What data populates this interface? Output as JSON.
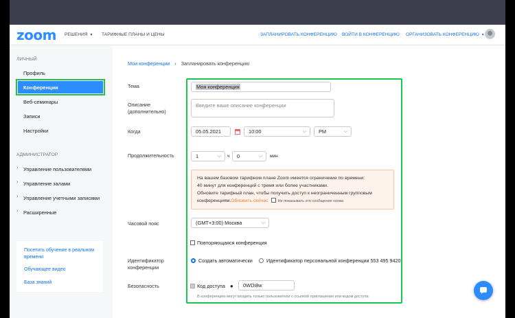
{
  "header": {
    "logo": "zoom",
    "nav": {
      "solutions": "РЕШЕНИЯ",
      "plans": "ТАРИФНЫЕ ПЛАНЫ И ЦЕНЫ",
      "schedule": "ЗАПЛАНИРОВАТЬ КОНФЕРЕНЦИЮ",
      "join": "ВОЙТИ В КОНФЕРЕНЦИЮ",
      "host": "ОРГАНИЗОВАТЬ КОНФЕРЕНЦИЮ"
    }
  },
  "sidebar": {
    "personal_heading": "ЛИЧНЫЙ",
    "personal_items": [
      "Профиль",
      "Конференции",
      "Веб-семинары",
      "Записи",
      "Настройки"
    ],
    "admin_heading": "АДМИНИСТРАТОР",
    "admin_items": [
      "Управление пользователями",
      "Управление залами",
      "Управление учетными записями",
      "Расширенные"
    ],
    "links": [
      "Посетить обучение в реальном времени",
      "Обучающее видео",
      "База знаний"
    ]
  },
  "breadcrumb": {
    "parent": "Мои конференции",
    "separator": "›",
    "current": "Запланировать конференцию"
  },
  "form": {
    "topic": {
      "label": "Тема",
      "value": "Моя конференция"
    },
    "description": {
      "label": "Описание (дополнительно)",
      "placeholder": "Введите ваше описание конференции"
    },
    "when": {
      "label": "Когда",
      "date": "05.05.2021",
      "time": "10:00",
      "ampm": "PM"
    },
    "duration": {
      "label": "Продолжительность",
      "hours": "1",
      "hours_unit": "ч",
      "minutes": "0",
      "minutes_unit": "мин"
    },
    "notice": {
      "line1": "На вашем базовом тарифном плане Zoom имеется ограничение по времени:",
      "line2": "40 минут для конференций с тремя или более участниками.",
      "line3": "Обновите тарифный план, чтобы получить доступ к неограниченным групповым",
      "line4": "конференциям.",
      "upgrade_link": "Обновить сейчас",
      "dont_show": "Не показывать это сообщение снова"
    },
    "timezone": {
      "label": "Часовой пояс",
      "value": "(GMT+3:00) Москва"
    },
    "recurring": {
      "label": "Повторяющаяся конференция"
    },
    "meeting_id": {
      "label": "Идентификатор конференции",
      "auto": "Создать автоматически",
      "personal": "Идентификатор персональной конференции 553 495 9420"
    },
    "security": {
      "label": "Безопасность",
      "passcode_label": "Код доступа",
      "passcode": "0WDi8w",
      "hint": "В конференцию могут входить только пользователи с ссылкой приглашения или кодом доступа"
    }
  },
  "colors": {
    "brand": "#2d8cff",
    "highlight": "#19c54a",
    "notice_link": "#ef7e33"
  }
}
